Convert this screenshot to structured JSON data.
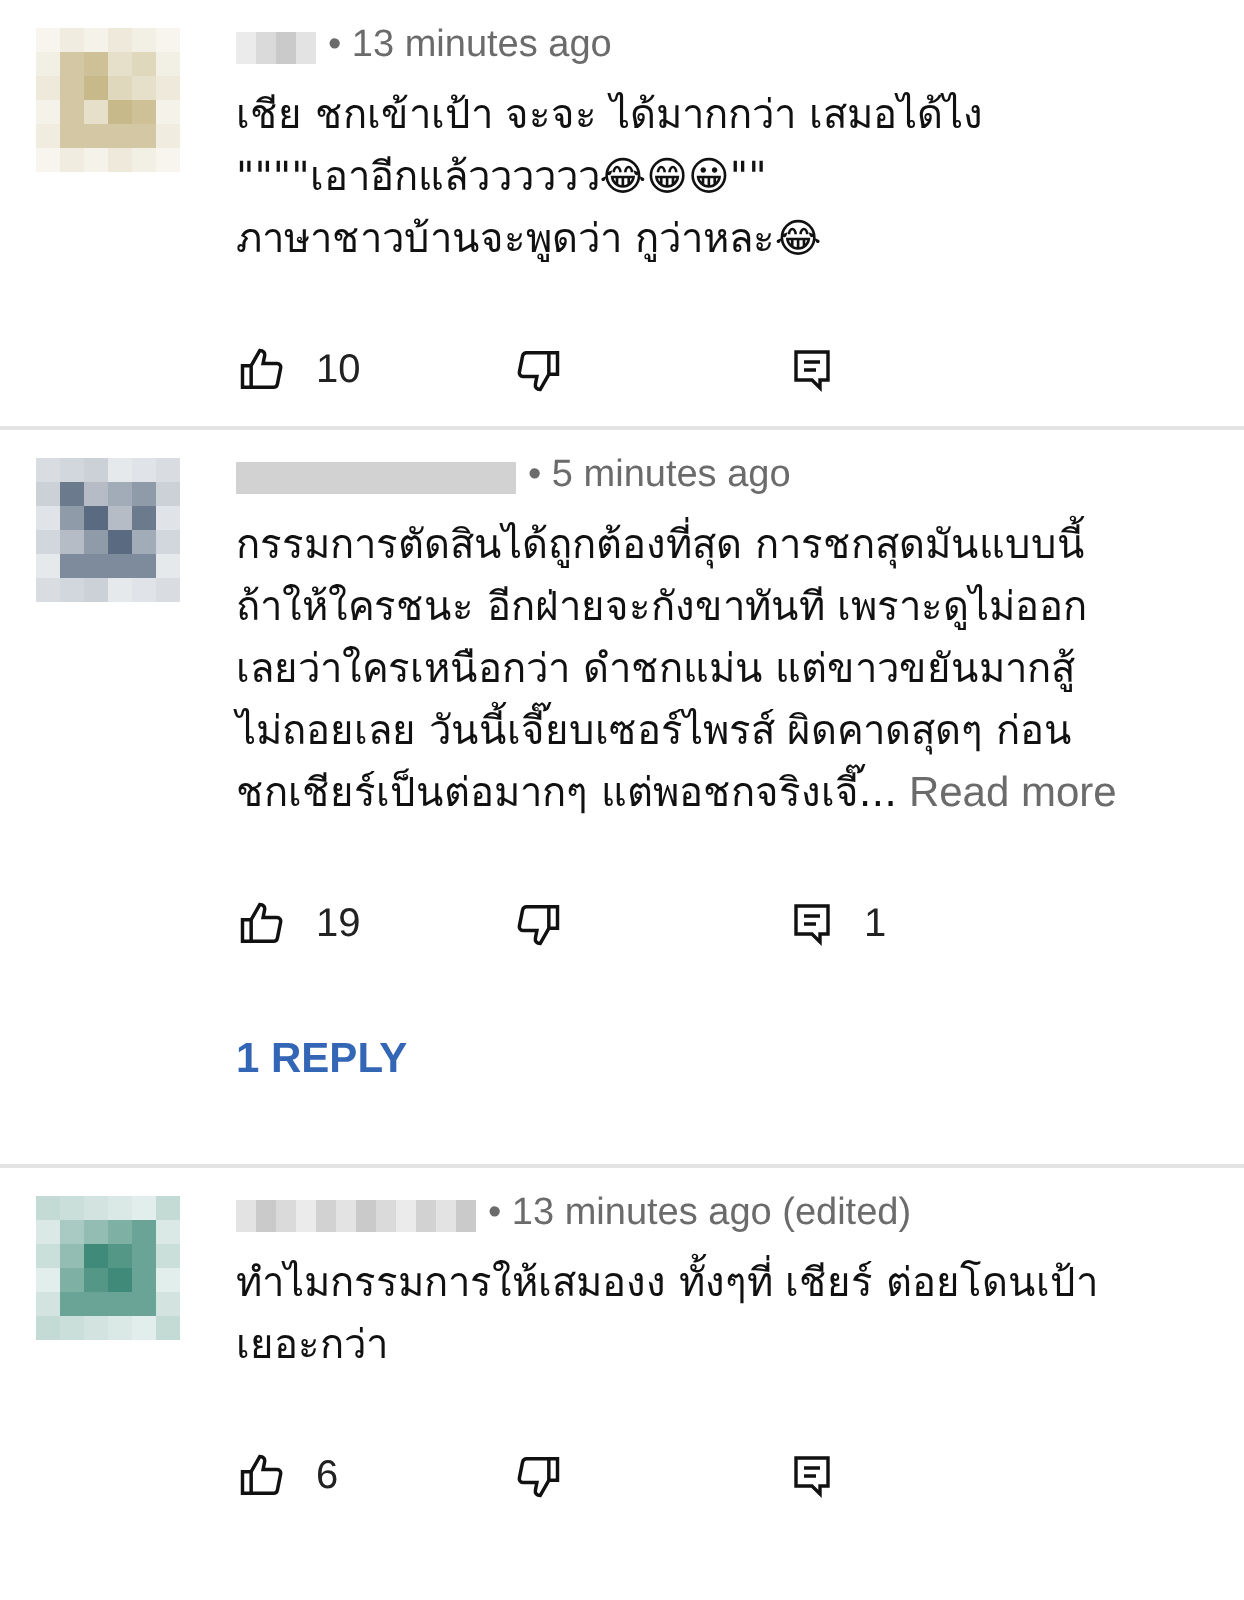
{
  "comments": [
    {
      "color": "#c8b98a",
      "time": "• 13 minutes ago",
      "body": "เชีย ชกเข้าเป้า จะจะ ได้มากกว่า เสมอได้ไง\n\"\"\"\"เอาอีกแล้วววววว😂😁😀\"\"\nภาษาชาวบ้านจะพูดว่า กูว่าหละ😂",
      "likes": "10"
    },
    {
      "color": "#5a6a80",
      "time": "• 5 minutes ago",
      "body": "กรรมการตัดสินได้ถูกต้องที่สุด การชกสุดมันแบบนี้\nถ้าให้ใครชนะ อีกฝ่ายจะกังขาทันที เพราะดูไม่ออก\nเลยว่าใครเหนือกว่า ดำชกแม่น แต่ขาวขยันมากสู้\nไม่ถอยเลย วันนี้เจี๊ยบเซอร์ไพรส์ ผิดคาดสุดๆ ก่อน\nชกเชียร์เป็นต่อมากๆ แต่พอชกจริงเจี๊...",
      "read_more": "Read more",
      "likes": "19",
      "replies_count": "1",
      "reply_link": "1 REPLY"
    },
    {
      "color": "#3f8a78",
      "time": "• 13 minutes ago (edited)",
      "body": "ทำไมกรรมการให้เสมองง ทั้งๆที่ เชียร์ ต่อยโดนเป้า\nเยอะกว่า",
      "likes": "6"
    }
  ]
}
